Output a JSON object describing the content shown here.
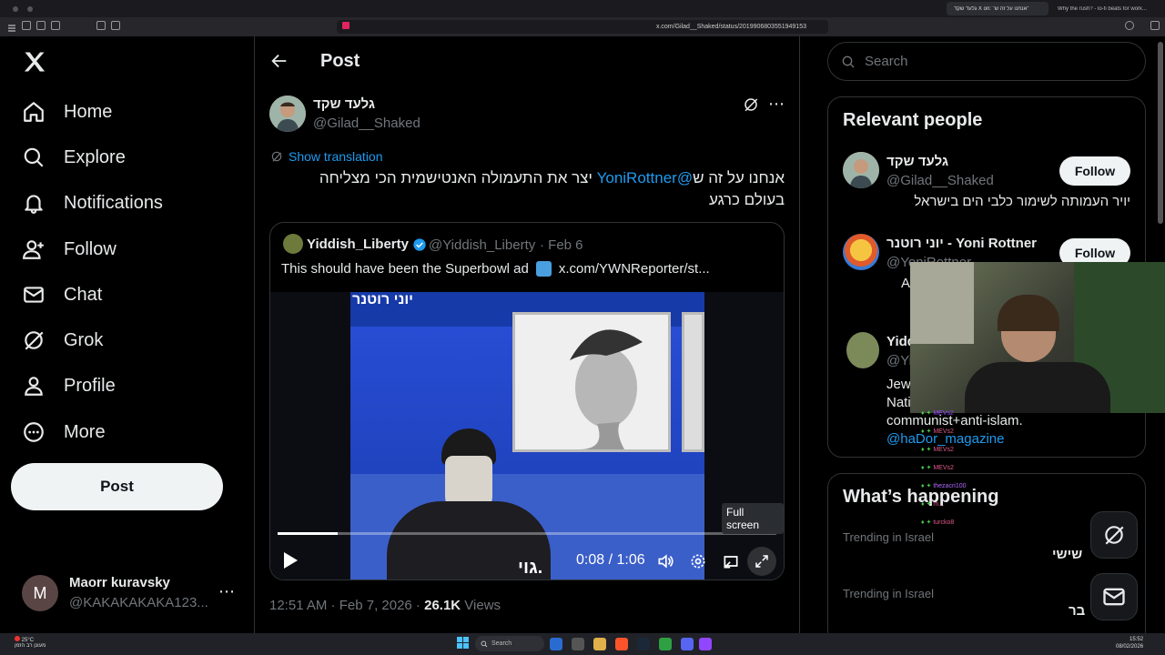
{
  "browser": {
    "tabs": [
      {
        "label": "גלעד שקד X on: \"אנחנו על זה ש\"",
        "active": true
      },
      {
        "label": "Why the rush? - lo-fi beats for work..."
      }
    ],
    "url": "x.com/Gilad__Shaked/status/2019906803551949153"
  },
  "nav": {
    "items": [
      {
        "label": "Home",
        "icon": "home-icon"
      },
      {
        "label": "Explore",
        "icon": "search-icon"
      },
      {
        "label": "Notifications",
        "icon": "bell-icon"
      },
      {
        "label": "Follow",
        "icon": "person-add-icon"
      },
      {
        "label": "Chat",
        "icon": "mail-icon"
      },
      {
        "label": "Grok",
        "icon": "grok-icon"
      },
      {
        "label": "Profile",
        "icon": "person-icon"
      },
      {
        "label": "More",
        "icon": "more-circle-icon"
      }
    ],
    "post_label": "Post",
    "account": {
      "avatar_letter": "M",
      "name": "Maorr kuravsky",
      "handle": "@KAKAKAKAKA123..."
    }
  },
  "main": {
    "title": "Post",
    "author": {
      "name": "גלעד שקד",
      "handle": "@Gilad__Shaked"
    },
    "show_translation": "Show translation",
    "text_prefix": "אנחנו על זה ש",
    "mention": "@YoniRottner",
    "text_suffix": " יצר את התעמולה האנטישמית הכי מצליחה",
    "text_line2": "בעולם כרגע",
    "quote": {
      "name": "Yiddish_Liberty",
      "handle": "@Yiddish_Liberty",
      "date": "· Feb 6",
      "text": "This should have been the Superbowl ad",
      "link": "x.com/YWNReporter/st...",
      "video_overlay_name": "יוני רוטנר",
      "video_caption": "גוי.",
      "time_current": "0:08",
      "time_sep": " / ",
      "time_total": "1:06",
      "progress_fraction": 0.12,
      "tooltip": "Full screen"
    },
    "meta": {
      "time": "12:51 AM · Feb 7, 2026 · ",
      "views_count": "26.1K",
      "views_label": " Views"
    }
  },
  "right": {
    "search_placeholder": "Search",
    "relevant_title": "Relevant people",
    "people": [
      {
        "name": "גלעד שקד",
        "handle": "@Gilad__Shaked",
        "bio": "יויר העמותה לשימור כלבי הים בישראל",
        "follow": "Follow"
      },
      {
        "name": "יוני רוטנר - Yoni Rottner",
        "handle": "@YoniRottner",
        "bio": "Al",
        "follow": "Follow"
      },
      {
        "name": "Yidd",
        "handle": "@Yi",
        "bio_line1": "Jewi",
        "bio_line2": "Nati",
        "bio_line3": "communist+anti-islam.",
        "bio_link": "@haDor_magazine"
      }
    ],
    "happening_title": "What’s happening",
    "trends": [
      {
        "context": "Trending in Israel",
        "topic": "שישי"
      },
      {
        "context": "Trending in Israel",
        "topic": "בר"
      }
    ]
  },
  "overlay": {
    "chat": [
      {
        "user": "MEVs2",
        "msg": ""
      },
      {
        "user": "MEVs2",
        "msg": ""
      },
      {
        "user": "MEVs2",
        "msg": ""
      },
      {
        "user": "MEVs2",
        "msg": ""
      },
      {
        "user": "thezacri100",
        "msg": ""
      },
      {
        "user": "m...",
        "msg": ""
      },
      {
        "user": "turcko8",
        "msg": ""
      }
    ]
  },
  "taskbar": {
    "weather_temp": "25°C",
    "weather_desc": "מעונן רב הזמן",
    "search_label": "Search",
    "clock_time": "15:52",
    "clock_date": "08/02/2026"
  },
  "colors": {
    "accent": "#1d9bf0",
    "bg": "#000000",
    "border": "#2f3336",
    "muted": "#71767b"
  }
}
